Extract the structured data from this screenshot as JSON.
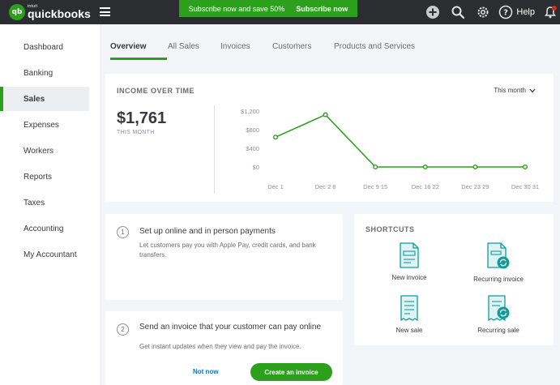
{
  "header": {
    "logo_small": "intuit",
    "logo_main": "quickbooks",
    "logo_badge": "qb",
    "promo_text": "Subscribe now and save 50%",
    "promo_link": "Subscribe now",
    "help_label": "Help"
  },
  "sidebar": {
    "items": [
      {
        "label": "Dashboard"
      },
      {
        "label": "Banking"
      },
      {
        "label": "Sales",
        "active": true
      },
      {
        "label": "Expenses"
      },
      {
        "label": "Workers"
      },
      {
        "label": "Reports"
      },
      {
        "label": "Taxes"
      },
      {
        "label": "Accounting"
      },
      {
        "label": "My Accountant"
      }
    ]
  },
  "tabs": [
    {
      "label": "Overview",
      "active": true
    },
    {
      "label": "All Sales"
    },
    {
      "label": "Invoices"
    },
    {
      "label": "Customers"
    },
    {
      "label": "Products and Services"
    }
  ],
  "income": {
    "title": "INCOME OVER TIME",
    "amount": "$1,761",
    "amount_sub": "THIS MONTH",
    "period": "This month"
  },
  "chart_data": {
    "type": "line",
    "title": "",
    "xlabel": "",
    "ylabel": "",
    "categories": [
      "Dec 1",
      "Dec 2 8",
      "Dec 9 15",
      "Dec 16 22",
      "Dec 23 29",
      "Dec 30 31"
    ],
    "y_ticks": [
      "$1,200",
      "$800",
      "$400",
      "$0"
    ],
    "ylim": [
      0,
      1200
    ],
    "values": [
      640,
      1121,
      0,
      0,
      0,
      0
    ],
    "color": "#2ca01c",
    "grid": false
  },
  "setup": [
    {
      "step": "1",
      "title": "Set up online and in person payments",
      "desc": "Let customers pay you with Apple Pay, credit cards, and bank transfers."
    },
    {
      "step": "2",
      "title": "Send an invoice that your customer can pay online",
      "desc": "Get instant updates when they view and pay the invoice.",
      "secondary_action": "Not now",
      "primary_action": "Create an invoice"
    }
  ],
  "shortcuts": {
    "title": "SHORTCUTS",
    "items": [
      {
        "label": "New invoice",
        "icon": "invoice-icon"
      },
      {
        "label": "Recurring invoice",
        "icon": "recurring-invoice-icon"
      },
      {
        "label": "New sale",
        "icon": "receipt-icon"
      },
      {
        "label": "Recurring sale",
        "icon": "recurring-sale-icon"
      }
    ]
  },
  "colors": {
    "brand": "#2ca01c",
    "topbar": "#2b2d30",
    "link": "#0077c5",
    "icon_teal": "#0f9d9d"
  }
}
